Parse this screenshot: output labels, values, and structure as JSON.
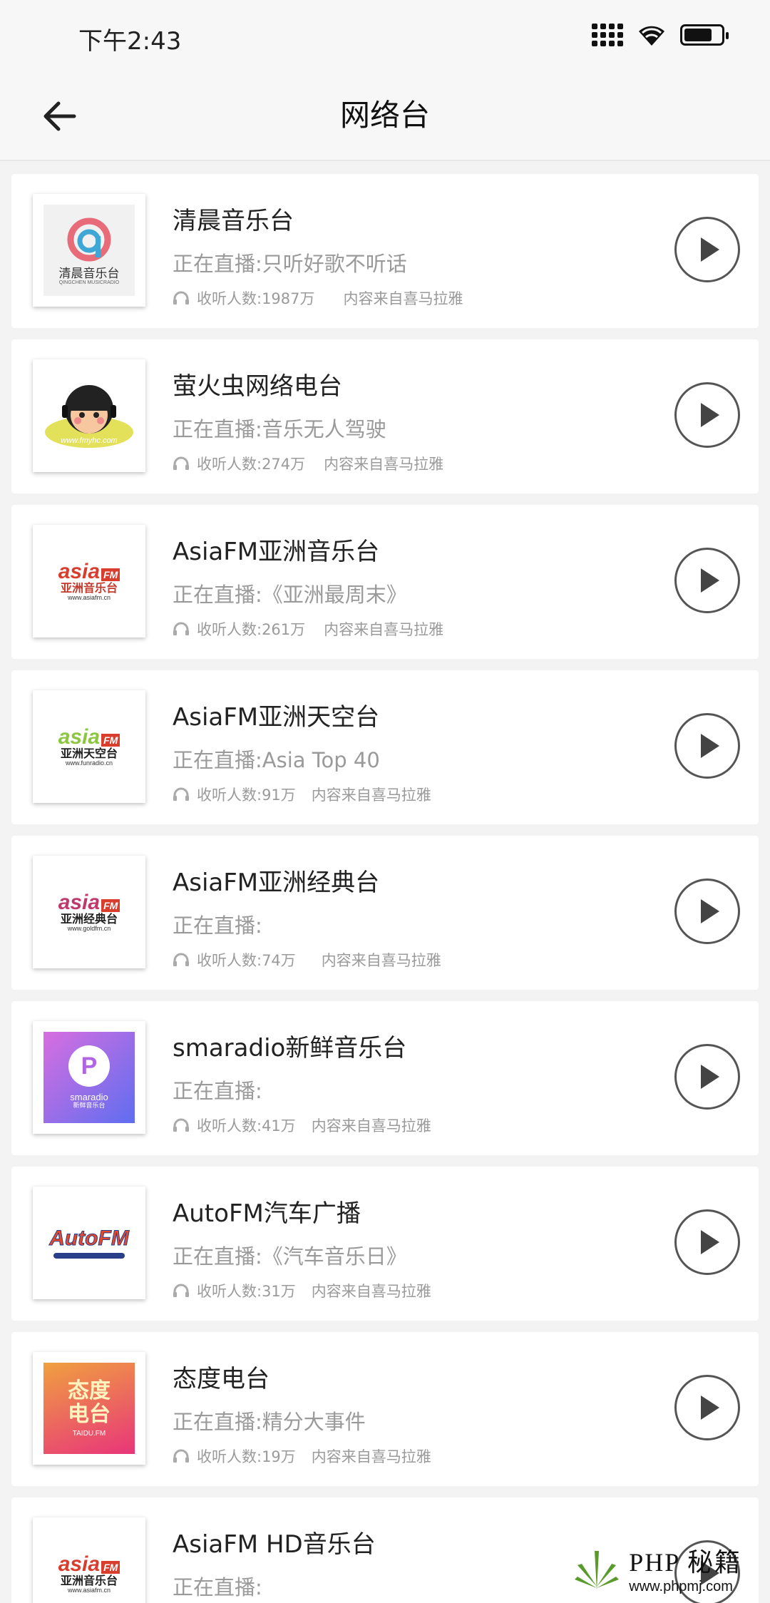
{
  "status_bar": {
    "time": "下午2:43"
  },
  "app_bar": {
    "title": "网络台"
  },
  "stations": [
    {
      "name": "清晨音乐台",
      "live": "正在直播:只听好歌不听话",
      "listeners": "收听人数:1987万",
      "source": "内容来自喜马拉雅",
      "logo_text": "清晨音乐台",
      "logo_sub": "QINGCHEN MUSICRADIO"
    },
    {
      "name": "萤火虫网络电台",
      "live": "正在直播:音乐无人驾驶",
      "listeners": "收听人数:274万",
      "source": "内容来自喜马拉雅",
      "logo_text": "www.fmyhc.com"
    },
    {
      "name": "AsiaFM亚洲音乐台",
      "live": "正在直播:《亚洲最周末》",
      "listeners": "收听人数:261万",
      "source": "内容来自喜马拉雅",
      "logo_text": "亚洲音乐台",
      "logo_sub": "www.asiafm.cn"
    },
    {
      "name": "AsiaFM亚洲天空台",
      "live": "正在直播:Asia Top 40",
      "listeners": "收听人数:91万",
      "source": "内容来自喜马拉雅",
      "logo_text": "亚洲天空台",
      "logo_sub": "www.funradio.cn"
    },
    {
      "name": "AsiaFM亚洲经典台",
      "live": "正在直播:",
      "listeners": "收听人数:74万",
      "source": "内容来自喜马拉雅",
      "logo_text": "亚洲经典台",
      "logo_sub": "www.goldfm.cn"
    },
    {
      "name": "smaradio新鲜音乐台",
      "live": "正在直播:",
      "listeners": "收听人数:41万",
      "source": "内容来自喜马拉雅",
      "logo_text": "smaradio",
      "logo_sub": "新鲜音乐台"
    },
    {
      "name": "AutoFM汽车广播",
      "live": "正在直播:《汽车音乐日》",
      "listeners": "收听人数:31万",
      "source": "内容来自喜马拉雅",
      "logo_text": "AutoFM"
    },
    {
      "name": "态度电台",
      "live": "正在直播:精分大事件",
      "listeners": "收听人数:19万",
      "source": "内容来自喜马拉雅",
      "logo_text": "态度电台",
      "logo_sub": "TAIDU.FM"
    },
    {
      "name": "AsiaFM HD音乐台",
      "live": "正在直播:",
      "listeners": "",
      "source": "",
      "logo_text": "亚洲音乐台",
      "logo_sub": "www.asiafm.cn"
    }
  ],
  "watermark": {
    "main": "PHP 秘籍",
    "sub": "www.phpmj.com"
  }
}
